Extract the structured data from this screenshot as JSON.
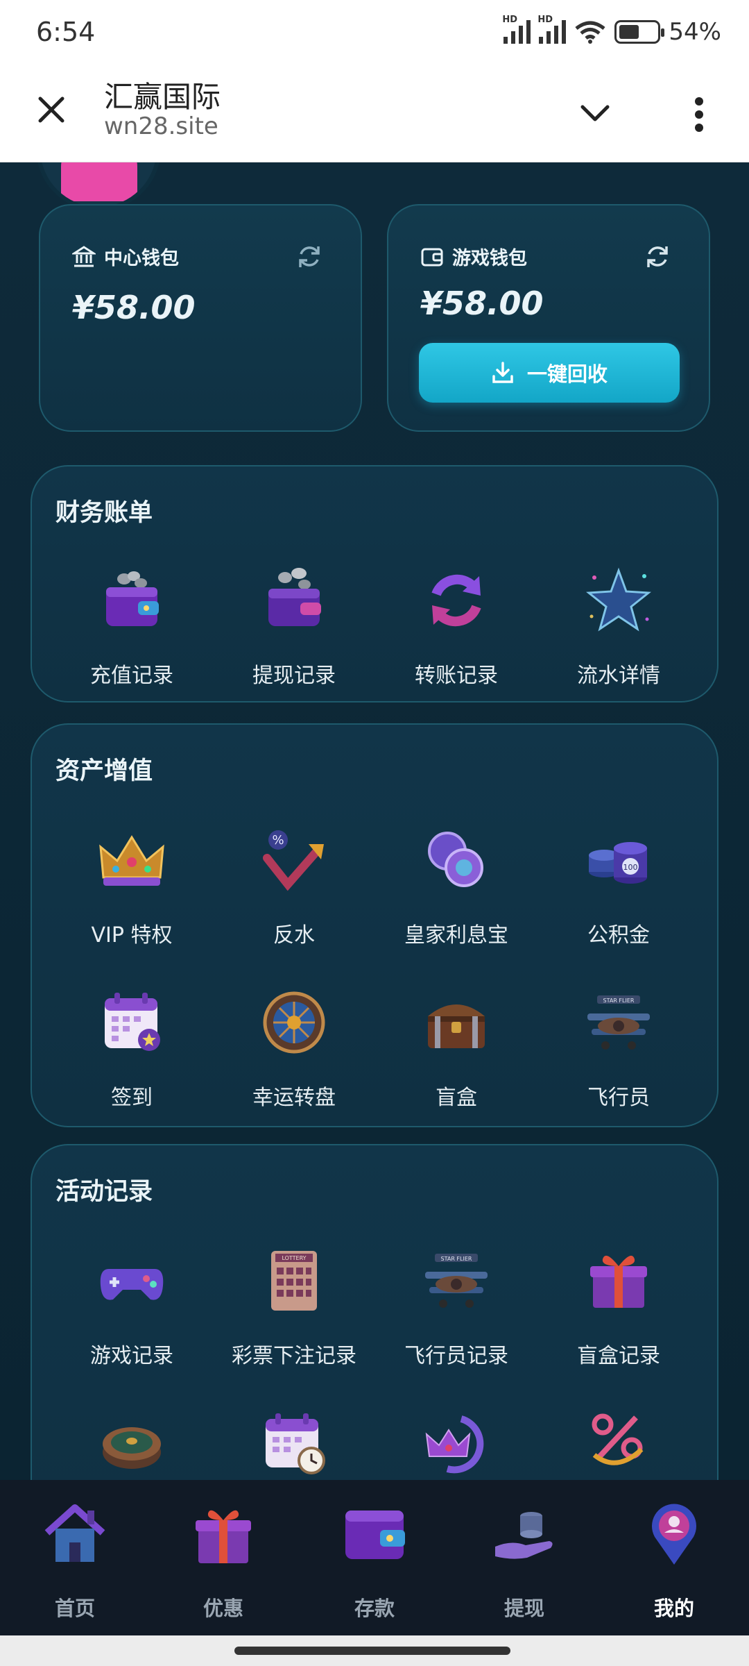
{
  "status": {
    "time": "6:54",
    "battery": "54%"
  },
  "topbar": {
    "title": "汇赢国际",
    "url": "wn28.site"
  },
  "wallets": {
    "center": {
      "label": "中心钱包",
      "amount": "¥58.00"
    },
    "game": {
      "label": "游戏钱包",
      "amount": "¥58.00",
      "recycle_label": "一键回收"
    }
  },
  "finance": {
    "title": "财务账单",
    "items": [
      {
        "label": "充值记录",
        "icon": "wallet-coins-icon"
      },
      {
        "label": "提现记录",
        "icon": "wallet-withdraw-icon"
      },
      {
        "label": "转账记录",
        "icon": "transfer-cycle-icon"
      },
      {
        "label": "流水详情",
        "icon": "star-icon"
      }
    ]
  },
  "assets": {
    "title": "资产增值",
    "items": [
      {
        "label": "VIP 特权",
        "icon": "crown-icon"
      },
      {
        "label": "反水",
        "icon": "rebate-percent-icon"
      },
      {
        "label": "皇家利息宝",
        "icon": "coins-icon"
      },
      {
        "label": "公积金",
        "icon": "chips-stack-icon"
      },
      {
        "label": "签到",
        "icon": "calendar-icon"
      },
      {
        "label": "幸运转盘",
        "icon": "wheel-icon"
      },
      {
        "label": "盲盒",
        "icon": "chest-icon"
      },
      {
        "label": "飞行员",
        "icon": "plane-icon"
      }
    ]
  },
  "activity": {
    "title": "活动记录",
    "items": [
      {
        "label": "游戏记录",
        "icon": "gamepad-icon"
      },
      {
        "label": "彩票下注记录",
        "icon": "lottery-ticket-icon"
      },
      {
        "label": "飞行员记录",
        "icon": "plane-record-icon"
      },
      {
        "label": "盲盒记录",
        "icon": "gift-box-icon"
      },
      {
        "label": "",
        "icon": "roulette-icon"
      },
      {
        "label": "",
        "icon": "calendar-clock-icon"
      },
      {
        "label": "",
        "icon": "crown-return-icon"
      },
      {
        "label": "",
        "icon": "percent-arrow-icon"
      }
    ]
  },
  "nav": [
    {
      "label": "首页",
      "icon": "home-icon"
    },
    {
      "label": "优惠",
      "icon": "gift-icon"
    },
    {
      "label": "存款",
      "icon": "wallet-icon"
    },
    {
      "label": "提现",
      "icon": "hand-coins-icon"
    },
    {
      "label": "我的",
      "icon": "profile-pin-icon",
      "active": true
    }
  ],
  "colors": {
    "accent": "#1fb3d3",
    "panel": "#113549",
    "background": "#0b2432"
  }
}
